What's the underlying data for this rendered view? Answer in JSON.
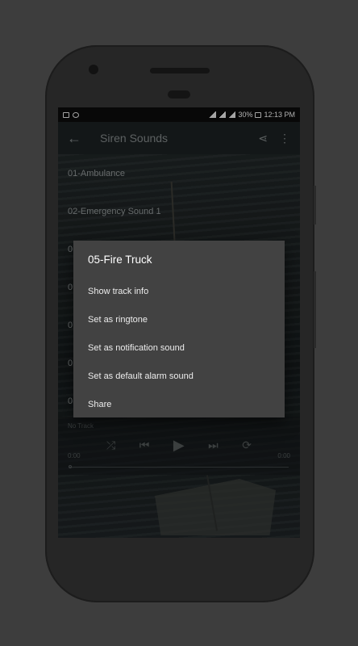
{
  "status_bar": {
    "battery": "30%",
    "time": "12:13 PM"
  },
  "toolbar": {
    "back_icon": "arrow-back-icon",
    "title": "Siren Sounds",
    "share_icon": "share-icon",
    "more_icon": "more-vert-icon"
  },
  "tracks": [
    {
      "label": "01-Ambulance"
    },
    {
      "label": "02-Emergency Sound 1"
    },
    {
      "label": "0"
    },
    {
      "label": "0"
    },
    {
      "label": "0"
    },
    {
      "label": "0"
    },
    {
      "label": "0"
    }
  ],
  "player": {
    "track_status": "No Track",
    "time_start": "0:00",
    "time_end": "0:00"
  },
  "dialog": {
    "title": "05-Fire Truck",
    "options": [
      {
        "label": "Show track info"
      },
      {
        "label": "Set as ringtone"
      },
      {
        "label": "Set as notification sound"
      },
      {
        "label": "Set as default alarm sound"
      },
      {
        "label": "Share"
      }
    ]
  }
}
